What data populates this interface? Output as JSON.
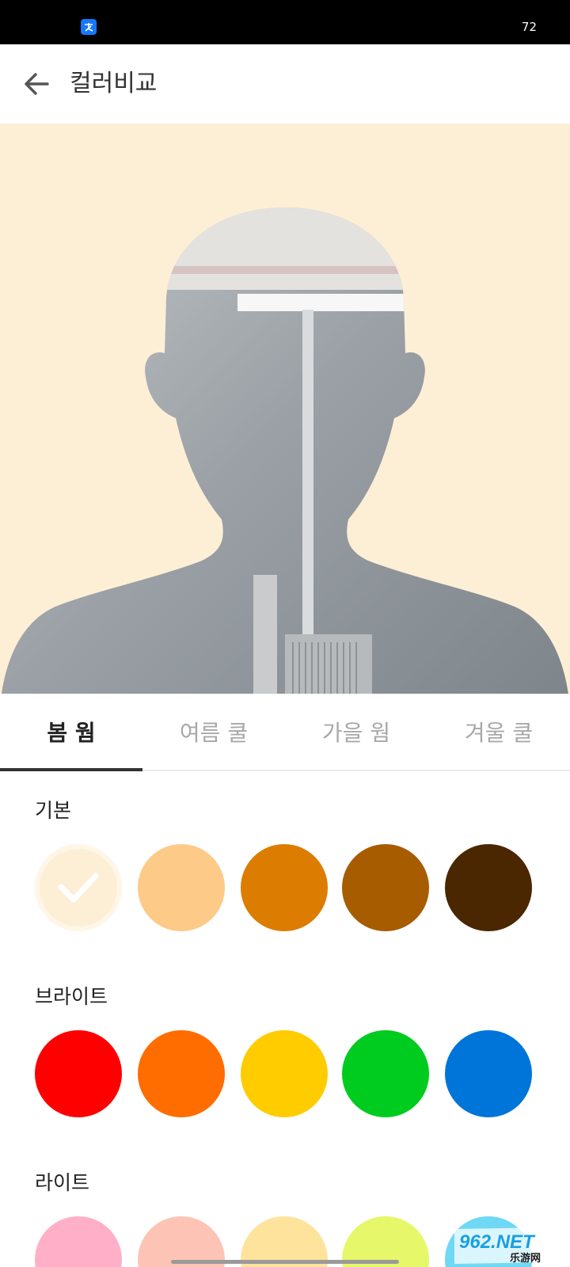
{
  "status_bar": {
    "app_icon": "alipay-icon",
    "battery": "72"
  },
  "app_bar": {
    "back_icon": "back-arrow-icon",
    "title": "컬러비교"
  },
  "preview": {
    "background_color": "#fdefd6",
    "figure": "person-silhouette"
  },
  "tabs": [
    {
      "label": "봄 웜",
      "active": true
    },
    {
      "label": "여름 쿨",
      "active": false
    },
    {
      "label": "가을 웜",
      "active": false
    },
    {
      "label": "겨울 쿨",
      "active": false
    }
  ],
  "sections": [
    {
      "title": "기본",
      "swatches": [
        {
          "color": "#fdefd6",
          "selected": true
        },
        {
          "color": "#fdca88",
          "selected": false
        },
        {
          "color": "#dc7c00",
          "selected": false
        },
        {
          "color": "#a75c00",
          "selected": false
        },
        {
          "color": "#4a2700",
          "selected": false
        }
      ]
    },
    {
      "title": "브라이트",
      "swatches": [
        {
          "color": "#ff0000",
          "selected": false
        },
        {
          "color": "#ff6d00",
          "selected": false
        },
        {
          "color": "#ffcc00",
          "selected": false
        },
        {
          "color": "#00cc1f",
          "selected": false
        },
        {
          "color": "#0075d9",
          "selected": false
        }
      ]
    },
    {
      "title": "라이트",
      "swatches": [
        {
          "color": "#ffb0c8",
          "selected": false
        },
        {
          "color": "#fdc4b6",
          "selected": false
        },
        {
          "color": "#fde39c",
          "selected": false
        },
        {
          "color": "#e6f76a",
          "selected": false
        },
        {
          "color": "#6fd8f5",
          "selected": false
        }
      ]
    }
  ],
  "watermark": {
    "logo_text": "962.NET",
    "sub_text": "乐游网"
  }
}
